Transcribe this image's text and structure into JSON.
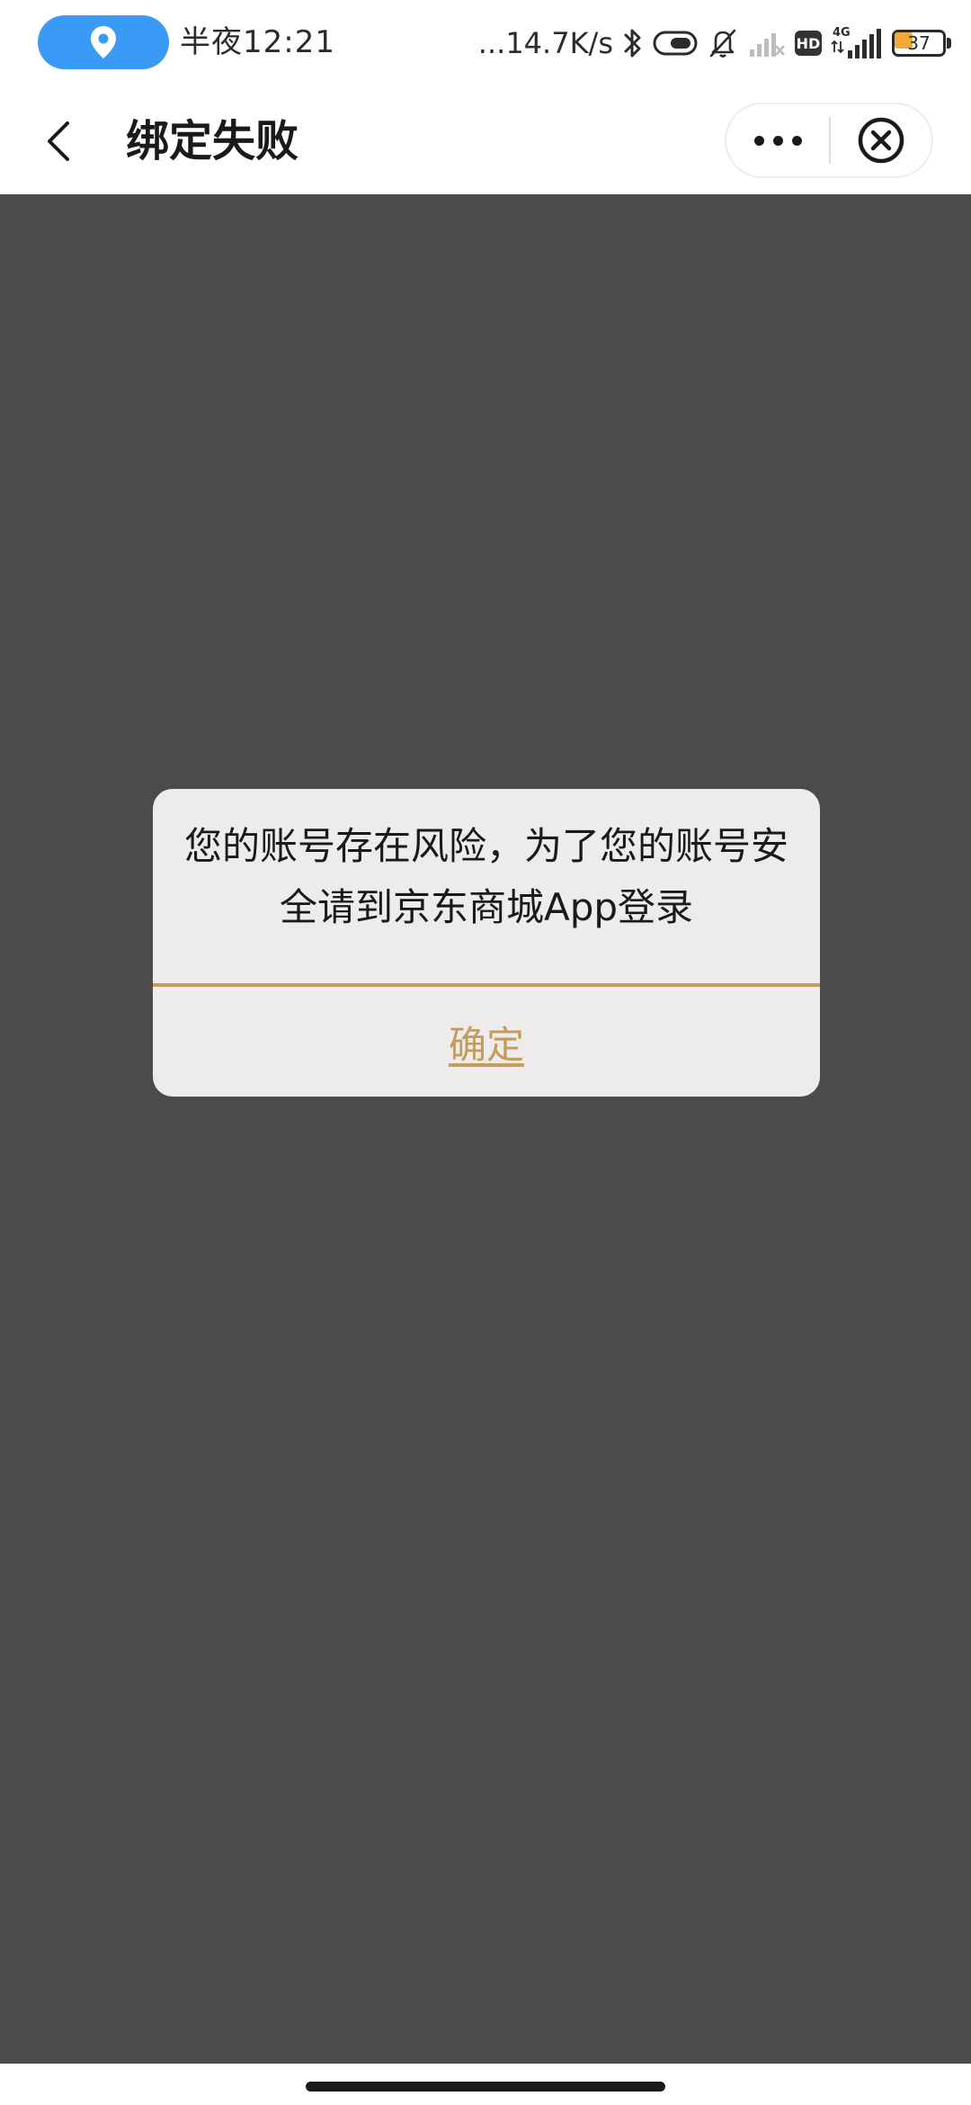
{
  "status_bar": {
    "time": "半夜12:21",
    "net_speed": "...14.7K/s",
    "hd_label": "HD",
    "network_type": "4G",
    "battery_level": "37",
    "battery_fraction": 0.37,
    "colors": {
      "location_pill": "#3a9bf6",
      "battery_fill": "#f3a83b"
    },
    "icons": [
      "location-pin-icon",
      "bluetooth-icon",
      "toggle-icon",
      "mute-bell-icon",
      "signal-no-sim-icon",
      "hd-icon",
      "signal-4g-icon",
      "battery-icon"
    ]
  },
  "nav": {
    "title": "绑定失败",
    "icons": [
      "back-arrow-icon",
      "more-dots-icon",
      "close-circle-icon"
    ]
  },
  "dialog": {
    "message": "您的账号存在风险，为了您的账号安全请到京东商城App登录",
    "confirm_label": "确定",
    "accent_color": "#c39c5c"
  },
  "colors": {
    "overlay": "#4b4b4b",
    "dialog_bg": "#eeebeb"
  }
}
